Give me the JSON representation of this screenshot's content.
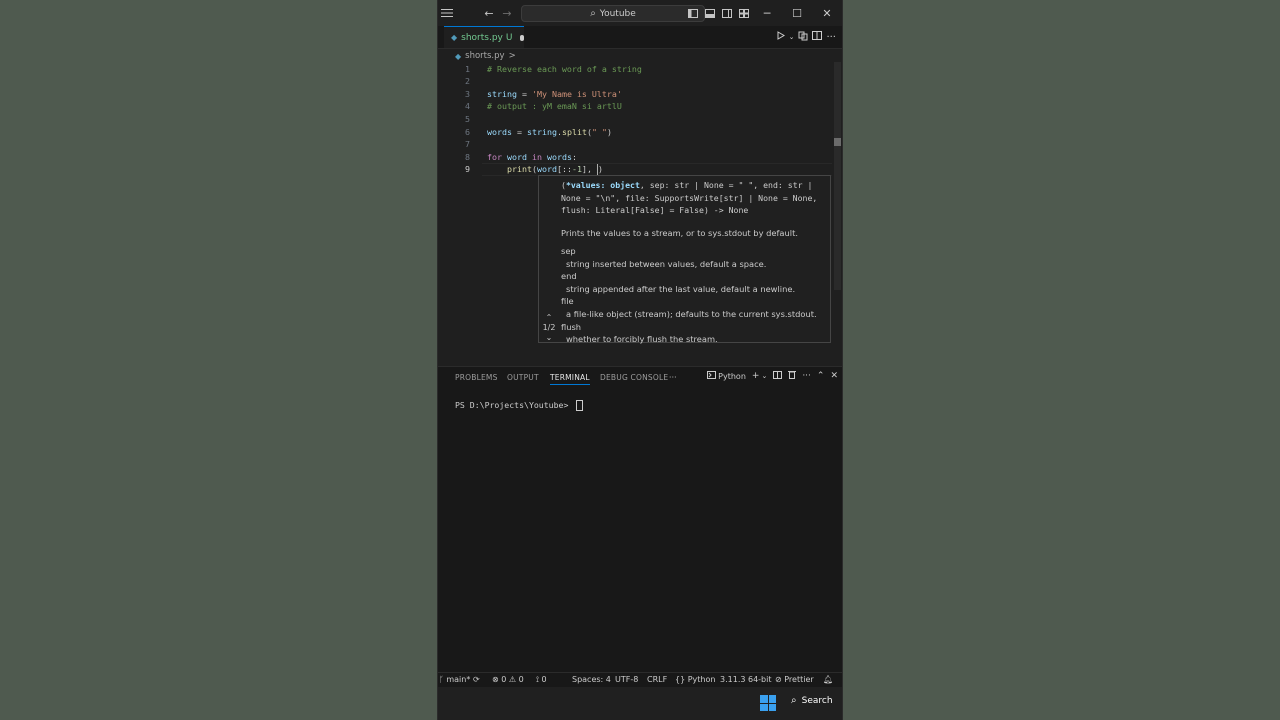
{
  "titlebar": {
    "search": "Youtube",
    "icons": [
      "menu-icon",
      "arrow-left-icon",
      "arrow-right-icon",
      "layout-sidebar-left-icon",
      "layout-panel-icon",
      "layout-sidebar-right-icon",
      "customize-layout-icon",
      "minimize-icon",
      "maximize-icon",
      "close-icon"
    ]
  },
  "tab": {
    "file": "shorts.py",
    "badge": "U"
  },
  "breadcrumb": {
    "file": "shorts.py",
    "chevron": ">"
  },
  "editor": {
    "lines": [
      {
        "n": "1",
        "segs": [
          {
            "c": "cm",
            "t": "# Reverse each word of a string"
          }
        ]
      },
      {
        "n": "2",
        "segs": []
      },
      {
        "n": "3",
        "segs": [
          {
            "c": "var",
            "t": "string"
          },
          {
            "c": "pl",
            "t": " = "
          },
          {
            "c": "str",
            "t": "'My Name is Ultra'"
          }
        ]
      },
      {
        "n": "4",
        "segs": [
          {
            "c": "cm",
            "t": "# output : yM emaN si artlU"
          }
        ]
      },
      {
        "n": "5",
        "segs": []
      },
      {
        "n": "6",
        "segs": [
          {
            "c": "var",
            "t": "words"
          },
          {
            "c": "pl",
            "t": " = "
          },
          {
            "c": "var",
            "t": "string"
          },
          {
            "c": "pl",
            "t": "."
          },
          {
            "c": "fn",
            "t": "split"
          },
          {
            "c": "pl",
            "t": "("
          },
          {
            "c": "str",
            "t": "\" \""
          },
          {
            "c": "pl",
            "t": ")"
          }
        ]
      },
      {
        "n": "7",
        "segs": []
      },
      {
        "n": "8",
        "segs": [
          {
            "c": "kw",
            "t": "for"
          },
          {
            "c": "pl",
            "t": " "
          },
          {
            "c": "var",
            "t": "word"
          },
          {
            "c": "pl",
            "t": " "
          },
          {
            "c": "kw",
            "t": "in"
          },
          {
            "c": "pl",
            "t": " "
          },
          {
            "c": "var",
            "t": "words"
          },
          {
            "c": "pl",
            "t": ":"
          }
        ]
      },
      {
        "n": "9",
        "segs": [
          {
            "c": "pl",
            "t": "    "
          },
          {
            "c": "fn",
            "t": "print"
          },
          {
            "c": "pl",
            "t": "("
          },
          {
            "c": "var",
            "t": "word"
          },
          {
            "c": "pl",
            "t": "[::"
          },
          {
            "c": "num",
            "t": "-1"
          },
          {
            "c": "pl",
            "t": "], "
          }
        ]
      }
    ]
  },
  "hover": {
    "sig1": "(",
    "sig_param": "*values: object",
    "sig_rest": ", sep: str | None = \" \", end: str | None = \"\\n\", file: SupportsWrite[str] | None = None, flush: Literal[False] = False) -> None",
    "desc": "Prints the values to a stream, or to sys.stdout by default.",
    "params": [
      {
        "name": "sep",
        "text": "string inserted between values, default a space."
      },
      {
        "name": "end",
        "text": "string appended after the last value, default a newline."
      },
      {
        "name": "file",
        "text": "a file-like object (stream); defaults to the current sys.stdout."
      },
      {
        "name": "flush",
        "text": "whether to forcibly flush the stream."
      }
    ],
    "counter": "1/2"
  },
  "panel": {
    "tabs": [
      "PROBLEMS",
      "OUTPUT",
      "TERMINAL",
      "DEBUG CONSOLE"
    ],
    "more": "···",
    "shell": "Python",
    "prompt": "PS D:\\Projects\\Youtube> "
  },
  "statusbar": {
    "branch": "main*",
    "errors": "0",
    "warnings": "0",
    "ports": "0",
    "spaces": "Spaces: 4",
    "encoding": "UTF-8",
    "eol": "CRLF",
    "language": "Python",
    "interpreter": "3.11.3 64-bit",
    "formatter": "Prettier"
  },
  "taskbar": {
    "search": "Search"
  },
  "colors": {
    "accent": "#0078d4",
    "untracked": "#73c991"
  }
}
